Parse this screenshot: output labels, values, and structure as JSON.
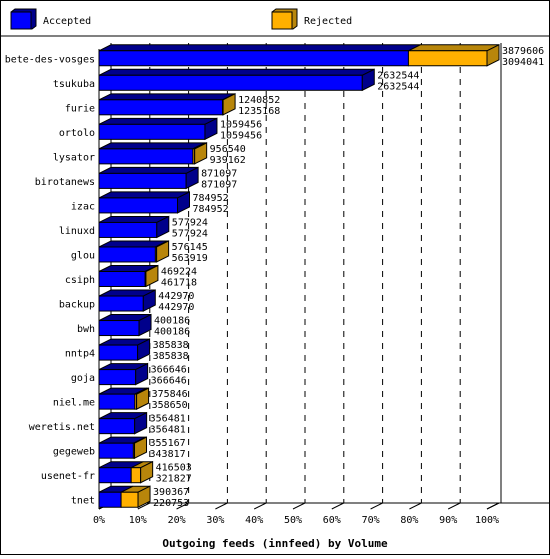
{
  "chart_data": {
    "type": "bar",
    "orientation": "horizontal",
    "stacked": true,
    "style": "3d",
    "title": "",
    "xlabel": "Outgoing feeds (innfeed) by Volume",
    "ylabel": "",
    "xlim_percent": [
      0,
      100
    ],
    "x_ticks": [
      "0%",
      "10%",
      "20%",
      "30%",
      "40%",
      "50%",
      "60%",
      "70%",
      "80%",
      "90%",
      "100%"
    ],
    "grid": "vertical dashed",
    "legend": {
      "placement": "top",
      "entries": [
        {
          "name": "Accepted",
          "color": "#0000ff"
        },
        {
          "name": "Rejected",
          "color": "#ffb000"
        }
      ]
    },
    "categories": [
      "bete-des-vosges",
      "tsukuba",
      "furie",
      "ortolo",
      "lysator",
      "birotanews",
      "izac",
      "linuxd",
      "glou",
      "csiph",
      "backup",
      "bwh",
      "nntp4",
      "goja",
      "niel.me",
      "weretis.net",
      "gegeweb",
      "usenet-fr",
      "tnet"
    ],
    "totals": [
      3879606,
      2632544,
      1240852,
      1059456,
      956540,
      871097,
      784952,
      577924,
      576145,
      469224,
      442970,
      400186,
      385838,
      366646,
      375846,
      356481,
      355167,
      416503,
      390367
    ],
    "series": [
      {
        "name": "Accepted",
        "values": [
          3094041,
          2632544,
          1235168,
          1059456,
          939162,
          871097,
          784952,
          577924,
          563919,
          461718,
          442970,
          400186,
          385838,
          366646,
          358650,
          356481,
          343817,
          321827,
          220753
        ]
      },
      {
        "name": "Rejected",
        "values": [
          785565,
          0,
          5684,
          0,
          17378,
          0,
          0,
          0,
          12226,
          7506,
          0,
          0,
          0,
          0,
          17196,
          0,
          11350,
          94676,
          169614
        ]
      }
    ],
    "colors": {
      "accepted_front": "#0000ff",
      "accepted_side": "#00008b",
      "rejected_front": "#ffb000",
      "rejected_side": "#b8860b"
    }
  }
}
